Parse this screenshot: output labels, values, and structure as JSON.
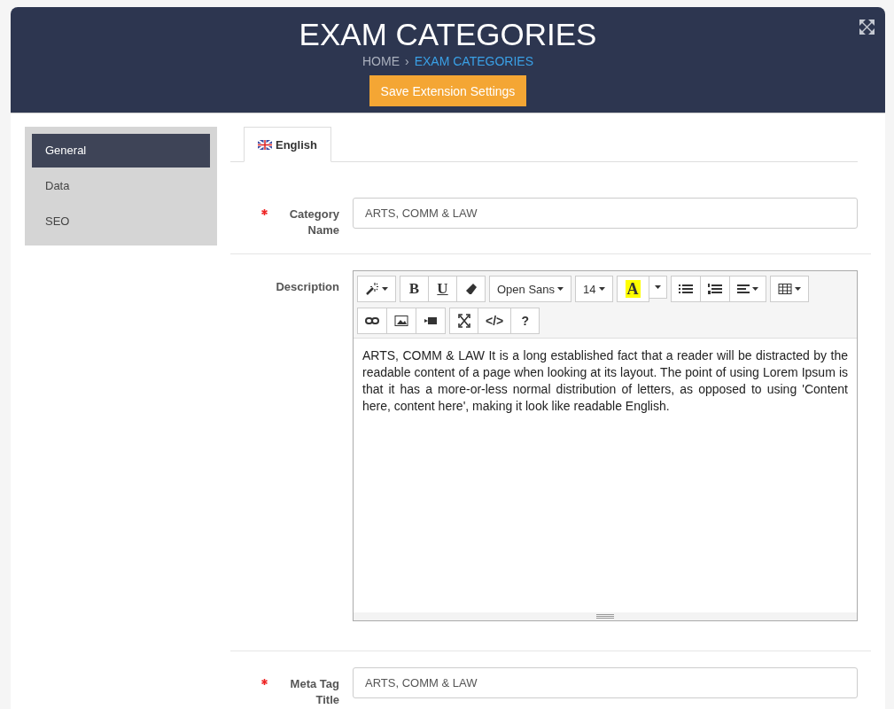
{
  "header": {
    "title": "EXAM CATEGORIES",
    "breadcrumb": [
      {
        "label": "HOME",
        "selected": false
      },
      {
        "label": "EXAM CATEGORIES",
        "selected": true
      }
    ],
    "breadcrumb_separator": "›",
    "save_button": "Save Extension Settings"
  },
  "sidebar": {
    "items": [
      {
        "label": "General",
        "selected": true
      },
      {
        "label": "Data",
        "selected": false
      },
      {
        "label": "SEO",
        "selected": false
      }
    ]
  },
  "language_tabs": [
    {
      "label": "English",
      "selected": true
    }
  ],
  "fields": [
    {
      "kind": "input",
      "label": "Category Name",
      "required": true,
      "value": "ARTS, COMM & LAW"
    },
    {
      "kind": "editor",
      "label": "Description",
      "required": false,
      "toolbar": [
        [
          {
            "kind": "magic"
          }
        ],
        [
          {
            "kind": "bold",
            "label": "B"
          },
          {
            "kind": "underline",
            "label": "U"
          },
          {
            "kind": "eraser"
          }
        ],
        [
          {
            "kind": "dropdown",
            "label": "Open Sans"
          }
        ],
        [
          {
            "kind": "dropdown",
            "label": "14"
          }
        ],
        [
          {
            "kind": "color",
            "label": "A"
          },
          {
            "kind": "caret"
          }
        ],
        [
          {
            "kind": "ul"
          },
          {
            "kind": "ol"
          },
          {
            "kind": "align"
          }
        ],
        [
          {
            "kind": "table"
          }
        ],
        [
          {
            "kind": "link"
          },
          {
            "kind": "image"
          },
          {
            "kind": "video"
          }
        ],
        [
          {
            "kind": "fullscreen"
          },
          {
            "kind": "text",
            "label": "</>"
          },
          {
            "kind": "text",
            "label": "?"
          }
        ]
      ],
      "value": "ARTS, COMM & LAW It is a long established fact that a reader will be distracted by the readable content of a page when looking at its layout. The point of using Lorem Ipsum is that it has a more-or-less normal distribution of letters, as opposed to using 'Content here, content here', making it look like readable English."
    },
    {
      "kind": "input",
      "label": "Meta Tag Title",
      "required": true,
      "value": "ARTS, COMM & LAW"
    }
  ]
}
